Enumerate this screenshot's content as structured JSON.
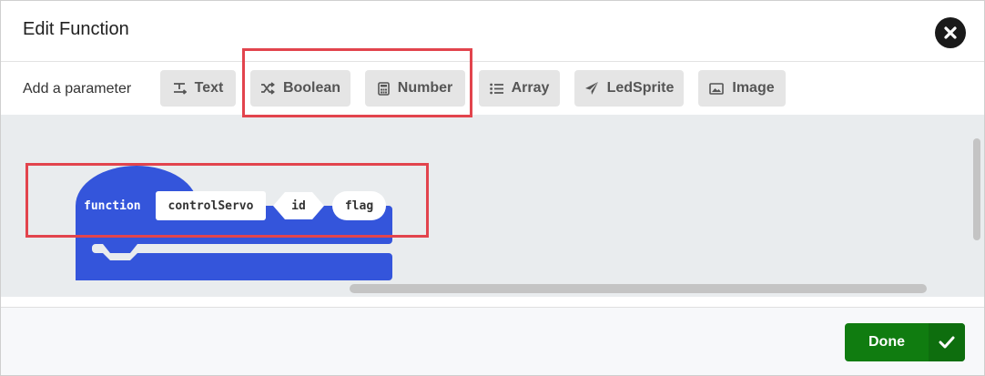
{
  "dialog": {
    "title": "Edit Function",
    "close_icon": "close-circle-icon"
  },
  "parameters": {
    "label": "Add a parameter",
    "buttons": [
      {
        "label": "Text",
        "icon": "text-icon"
      },
      {
        "label": "Boolean",
        "icon": "shuffle-icon"
      },
      {
        "label": "Number",
        "icon": "calculator-icon"
      },
      {
        "label": "Array",
        "icon": "list-icon"
      },
      {
        "label": "LedSprite",
        "icon": "paper-plane-icon"
      },
      {
        "label": "Image",
        "icon": "image-icon"
      }
    ]
  },
  "block": {
    "keyword": "function",
    "name": "controlServo",
    "params": [
      "id",
      "flag"
    ],
    "color": "#3455db"
  },
  "footer": {
    "done_label": "Done",
    "done_icon": "checkmark-icon",
    "done_color": "#107c10"
  },
  "highlight_color": "#e2444d"
}
